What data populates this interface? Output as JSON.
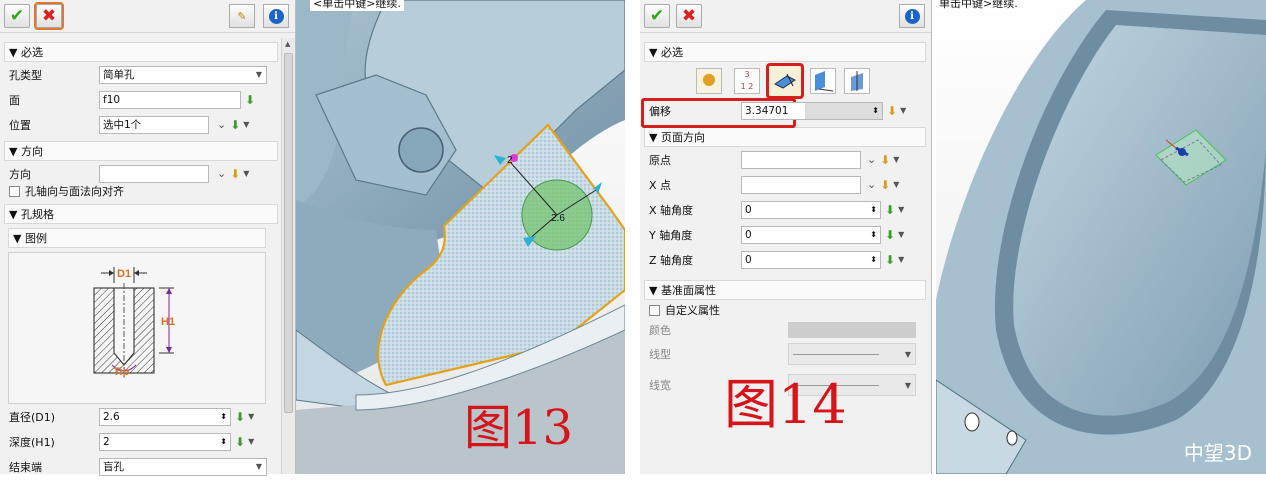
{
  "left_panel": {
    "sections": {
      "required": "必选",
      "direction": "方向",
      "spec": "孔规格",
      "legend": "图例"
    },
    "rows": {
      "hole_type": {
        "label": "孔类型",
        "value": "简单孔"
      },
      "face": {
        "label": "面",
        "value": "f10"
      },
      "position": {
        "label": "位置",
        "value": "选中1个"
      },
      "direction": {
        "label": "方向",
        "value": ""
      },
      "align": {
        "label": "孔轴向与面法向对齐"
      },
      "diameter": {
        "label": "直径(D1)",
        "value": "2.6"
      },
      "depth": {
        "label": "深度(H1)",
        "value": "2"
      },
      "end": {
        "label": "结束端",
        "value": "盲孔"
      }
    },
    "legend_labels": {
      "d1": "D1",
      "h1": "H1",
      "tip": "Tip"
    }
  },
  "viewport1": {
    "hint": "<单击中键>继续.",
    "dim1": "2",
    "dim2": "2.6",
    "caption": "图13"
  },
  "right_panel": {
    "sections": {
      "required": "必选",
      "plane_dir": "页面方向",
      "attrs": "基准面属性"
    },
    "offset": {
      "label": "偏移",
      "value": "3.34701"
    },
    "rows": {
      "origin": {
        "label": "原点",
        "value": ""
      },
      "xpoint": {
        "label": "X 点",
        "value": ""
      },
      "xangle": {
        "label": "X 轴角度",
        "value": "0"
      },
      "yangle": {
        "label": "Y 轴角度",
        "value": "0"
      },
      "zangle": {
        "label": "Z 轴角度",
        "value": "0"
      }
    },
    "custom": "自定义属性",
    "color": "颜色",
    "linetype": "线型",
    "linewidth": "线宽",
    "caption": "图14"
  },
  "viewport2": {
    "hint": "单击中键>继续.",
    "watermark": "中望3D"
  },
  "colors": {
    "accent_red": "#d6151b",
    "ok_green": "#2eaa12",
    "model_blue": "#8fb0c4"
  },
  "icons": [
    "check-icon",
    "cancel-icon",
    "brush-icon",
    "info-icon",
    "datum-plane-icon",
    "pick-icon",
    "spin-icon",
    "dropdown-icon"
  ]
}
